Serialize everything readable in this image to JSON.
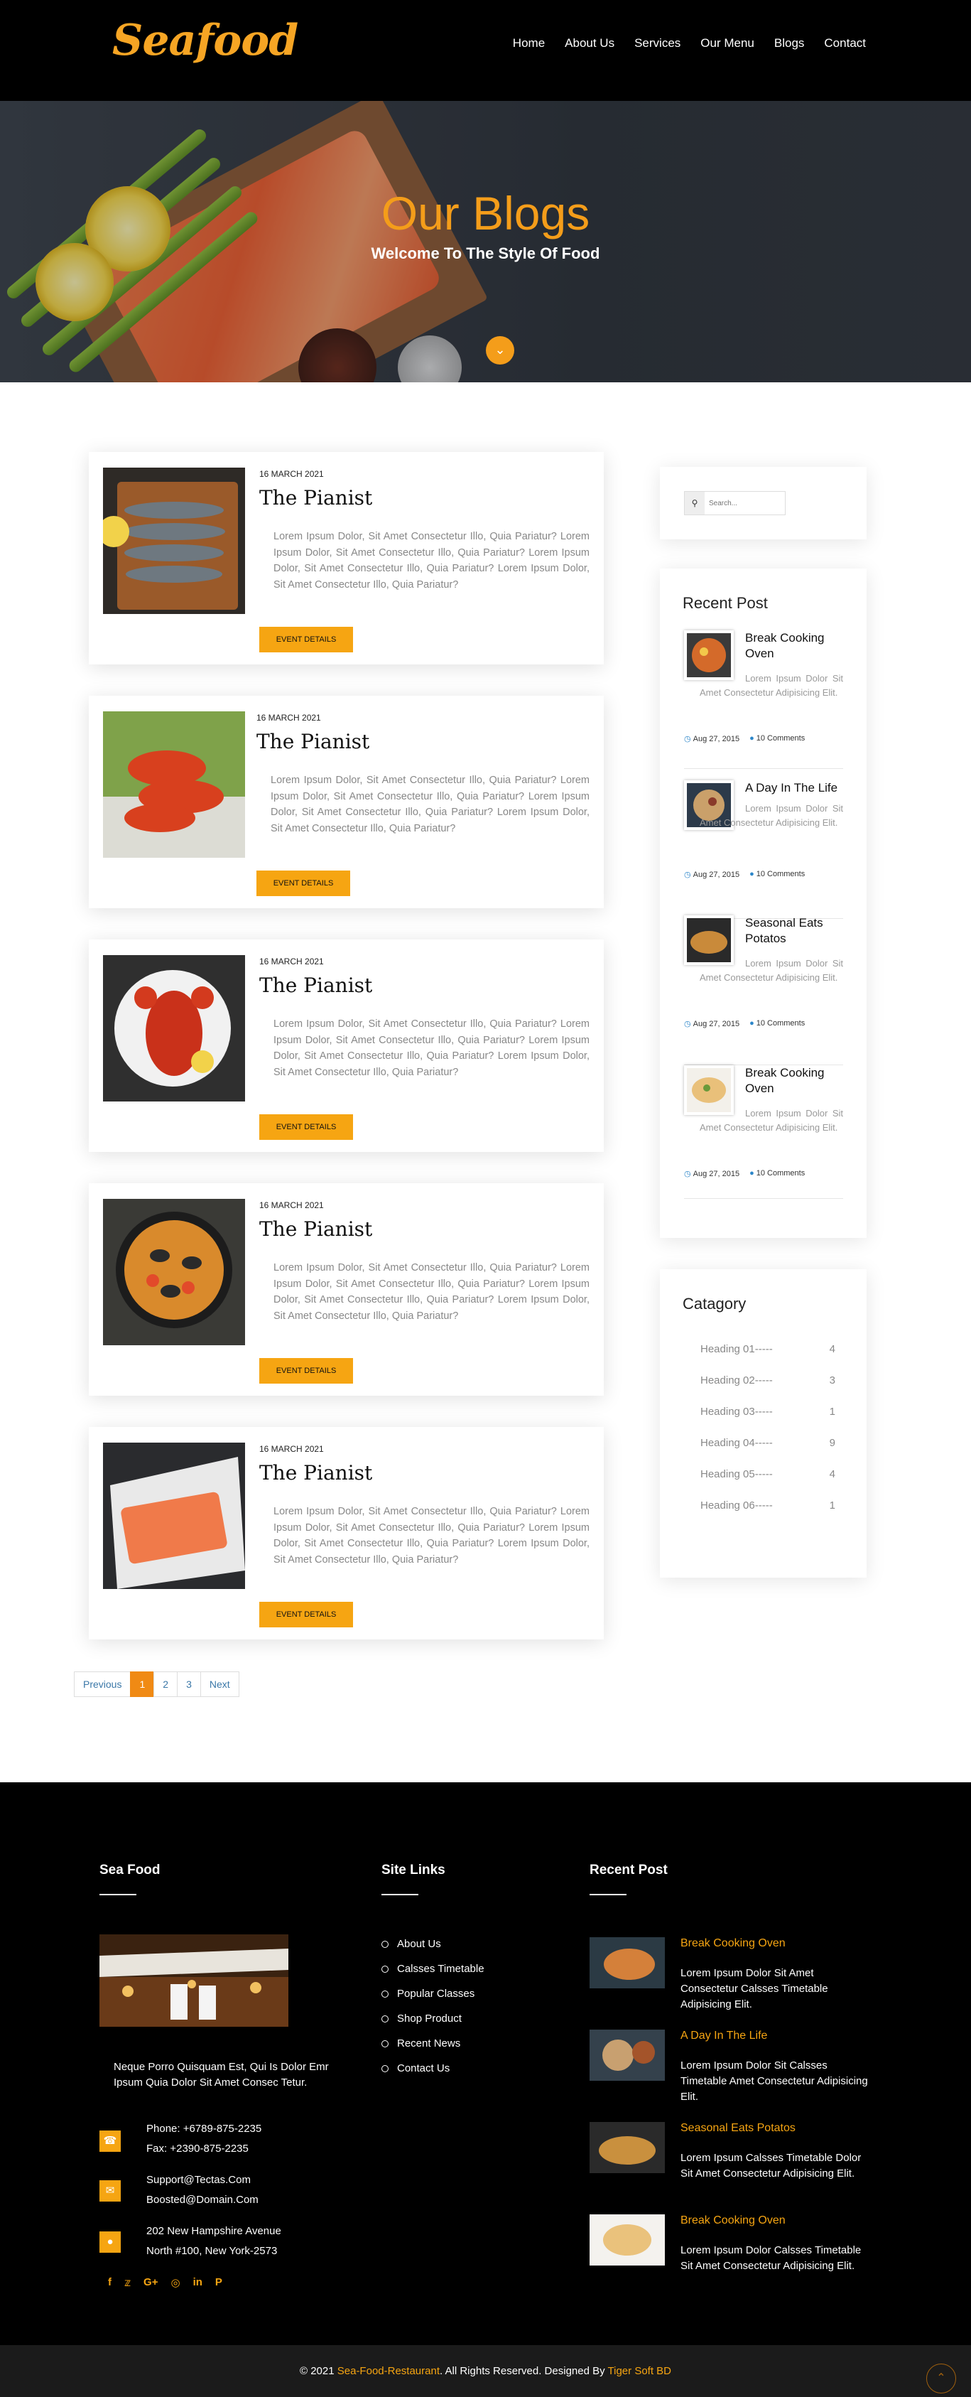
{
  "brand": {
    "logo_text": "Seafood"
  },
  "nav": [
    "Home",
    "About Us",
    "Services",
    "Our Menu",
    "Blogs",
    "Contact"
  ],
  "hero": {
    "title": "Our Blogs",
    "subtitle": "Welcome To The Style Of Food"
  },
  "posts": [
    {
      "date": "16 MARCH 2021",
      "title": "The Pianist",
      "body": "Lorem Ipsum Dolor, Sit Amet Consectetur Illo, Quia Pariatur? Lorem Ipsum Dolor, Sit Amet Consectetur Illo, Quia Pariatur? Lorem Ipsum Dolor, Sit Amet Consectetur Illo, Quia Pariatur? Lorem Ipsum Dolor, Sit Amet Consectetur Illo, Quia Pariatur?",
      "button": "EVENT DETAILS"
    },
    {
      "date": "16 MARCH 2021",
      "title": "The Pianist",
      "body": "Lorem Ipsum Dolor, Sit Amet Consectetur Illo, Quia Pariatur? Lorem Ipsum Dolor, Sit Amet Consectetur Illo, Quia Pariatur? Lorem Ipsum Dolor, Sit Amet Consectetur Illo, Quia Pariatur? Lorem Ipsum Dolor, Sit Amet Consectetur Illo, Quia Pariatur?",
      "button": "EVENT DETAILS"
    },
    {
      "date": "16 MARCH 2021",
      "title": "The Pianist",
      "body": "Lorem Ipsum Dolor, Sit Amet Consectetur Illo, Quia Pariatur? Lorem Ipsum Dolor, Sit Amet Consectetur Illo, Quia Pariatur? Lorem Ipsum Dolor, Sit Amet Consectetur Illo, Quia Pariatur? Lorem Ipsum Dolor, Sit Amet Consectetur Illo, Quia Pariatur?",
      "button": "EVENT DETAILS"
    },
    {
      "date": "16 MARCH 2021",
      "title": "The Pianist",
      "body": "Lorem Ipsum Dolor, Sit Amet Consectetur Illo, Quia Pariatur? Lorem Ipsum Dolor, Sit Amet Consectetur Illo, Quia Pariatur? Lorem Ipsum Dolor, Sit Amet Consectetur Illo, Quia Pariatur? Lorem Ipsum Dolor, Sit Amet Consectetur Illo, Quia Pariatur?",
      "button": "EVENT DETAILS"
    },
    {
      "date": "16 MARCH 2021",
      "title": "The Pianist",
      "body": "Lorem Ipsum Dolor, Sit Amet Consectetur Illo, Quia Pariatur? Lorem Ipsum Dolor, Sit Amet Consectetur Illo, Quia Pariatur? Lorem Ipsum Dolor, Sit Amet Consectetur Illo, Quia Pariatur? Lorem Ipsum Dolor, Sit Amet Consectetur Illo, Quia Pariatur?",
      "button": "EVENT DETAILS"
    }
  ],
  "pagination": [
    "Previous",
    "1",
    "2",
    "3",
    "Next"
  ],
  "sidebar": {
    "search_placeholder": "Search...",
    "recent_title": "Recent Post",
    "recent": [
      {
        "title": "Break Cooking Oven",
        "text": "Lorem Ipsum Dolor Sit Amet Consectetur Adipisicing Elit.",
        "date": "Aug 27, 2015",
        "comments": "10 Comments"
      },
      {
        "title": "A Day In The Life",
        "text": "Lorem Ipsum Dolor Sit Amet Consectetur Adipisicing Elit.",
        "date": "Aug 27, 2015",
        "comments": "10 Comments"
      },
      {
        "title": "Seasonal Eats Potatos",
        "text": "Lorem Ipsum Dolor Sit Amet Consectetur Adipisicing Elit.",
        "date": "Aug 27, 2015",
        "comments": "10 Comments"
      },
      {
        "title": "Break Cooking Oven",
        "text": "Lorem Ipsum Dolor Sit Amet Consectetur Adipisicing Elit.",
        "date": "Aug 27, 2015",
        "comments": "10 Comments"
      }
    ],
    "category_title": "Catagory",
    "categories": [
      {
        "name": "Heading 01-----",
        "count": "4"
      },
      {
        "name": "Heading 02-----",
        "count": "3"
      },
      {
        "name": "Heading 03-----",
        "count": "1"
      },
      {
        "name": "Heading 04-----",
        "count": "9"
      },
      {
        "name": "Heading 05-----",
        "count": "4"
      },
      {
        "name": "Heading 06-----",
        "count": "1"
      }
    ]
  },
  "footer": {
    "col1_title": "Sea Food",
    "about": "Neque Porro Quisquam Est, Qui Is Dolor Emr Ipsum Quia Dolor Sit Amet Consec Tetur.",
    "phone": "Phone: +6789-875-2235",
    "fax": "Fax: +2390-875-2235",
    "email1": "Support@Tectas.Com",
    "email2": "Boosted@Domain.Com",
    "address1": "202 New Hampshire Avenue",
    "address2": "North #100, New York-2573",
    "col2_title": "Site Links",
    "links": [
      "About Us",
      "Calsses Timetable",
      "Popular Classes",
      "Shop Product",
      "Recent News",
      "Contact Us"
    ],
    "col3_title": "Recent Post",
    "recent": [
      {
        "title": "Break Cooking Oven",
        "text": "Lorem Ipsum Dolor Sit Amet Consectetur Calsses Timetable Adipisicing Elit."
      },
      {
        "title": "A Day In The Life",
        "text": "Lorem Ipsum Dolor Sit Calsses Timetable Amet Consectetur Adipisicing Elit."
      },
      {
        "title": "Seasonal Eats Potatos",
        "text": "Lorem Ipsum Calsses Timetable Dolor Sit Amet Consectetur Adipisicing Elit."
      },
      {
        "title": "Break Cooking Oven",
        "text": "Lorem Ipsum Dolor Calsses Timetable Sit Amet Consectetur Adipisicing Elit."
      }
    ]
  },
  "copyright": {
    "prefix": "© 2021",
    "site": "Sea-Food-Restaurant",
    "mid": ". All Rights Reserved. Designed By",
    "designer": "Tiger Soft BD"
  },
  "colors": {
    "accent": "#f6a512",
    "dark": "#000000"
  }
}
